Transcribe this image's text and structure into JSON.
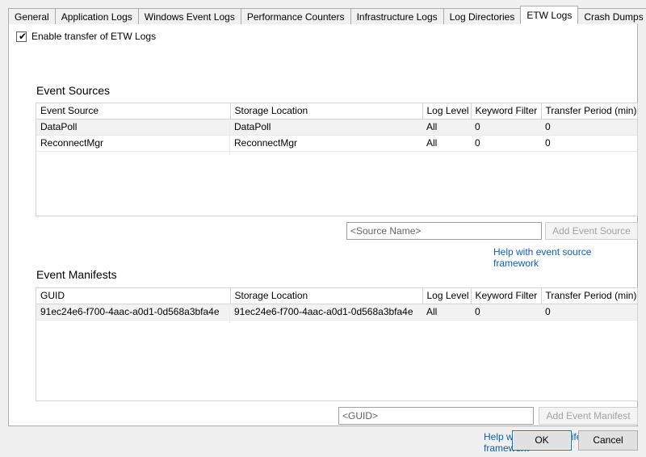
{
  "tabs": [
    {
      "label": "General",
      "active": false
    },
    {
      "label": "Application Logs",
      "active": false
    },
    {
      "label": "Windows Event Logs",
      "active": false
    },
    {
      "label": "Performance Counters",
      "active": false
    },
    {
      "label": "Infrastructure Logs",
      "active": false
    },
    {
      "label": "Log Directories",
      "active": false
    },
    {
      "label": "ETW Logs",
      "active": true
    },
    {
      "label": "Crash Dumps",
      "active": false
    }
  ],
  "enable_checkbox": {
    "label": "Enable transfer of ETW Logs",
    "checked": true,
    "tick": "✔"
  },
  "event_sources": {
    "title": "Event Sources",
    "columns": [
      "Event Source",
      "Storage Location",
      "Log Level",
      "Keyword Filter",
      "Transfer Period (min)"
    ],
    "rows": [
      {
        "source": "DataPoll",
        "storage": "DataPoll",
        "log_level": "All",
        "keyword_filter": "0",
        "transfer_period": "0"
      },
      {
        "source": "ReconnectMgr",
        "storage": "ReconnectMgr",
        "log_level": "All",
        "keyword_filter": "0",
        "transfer_period": "0"
      }
    ],
    "input_placeholder": "<Source Name>",
    "input_value": "",
    "add_button": "Add Event Source",
    "help_link": "Help with event source framework"
  },
  "event_manifests": {
    "title": "Event Manifests",
    "columns": [
      "GUID",
      "Storage Location",
      "Log Level",
      "Keyword Filter",
      "Transfer Period (min)"
    ],
    "rows": [
      {
        "guid": "91ec24e6-f700-4aac-a0d1-0d568a3bfa4e",
        "storage": "91ec24e6-f700-4aac-a0d1-0d568a3bfa4e",
        "log_level": "All",
        "keyword_filter": "0",
        "transfer_period": "0"
      }
    ],
    "input_placeholder": "<GUID>",
    "input_value": "",
    "add_button": "Add Event Manifest",
    "help_link": "Help with event manifest framework"
  },
  "footer": {
    "ok_label": "OK",
    "cancel_label": "Cancel"
  },
  "colors": {
    "link": "#0c5fb5",
    "focus_border": "#0078d7",
    "panel_bg": "#ffffff",
    "window_bg": "#f0f0f0",
    "row_alt_bg": "#f2f2f2",
    "grid_border": "#d4d4d4"
  }
}
